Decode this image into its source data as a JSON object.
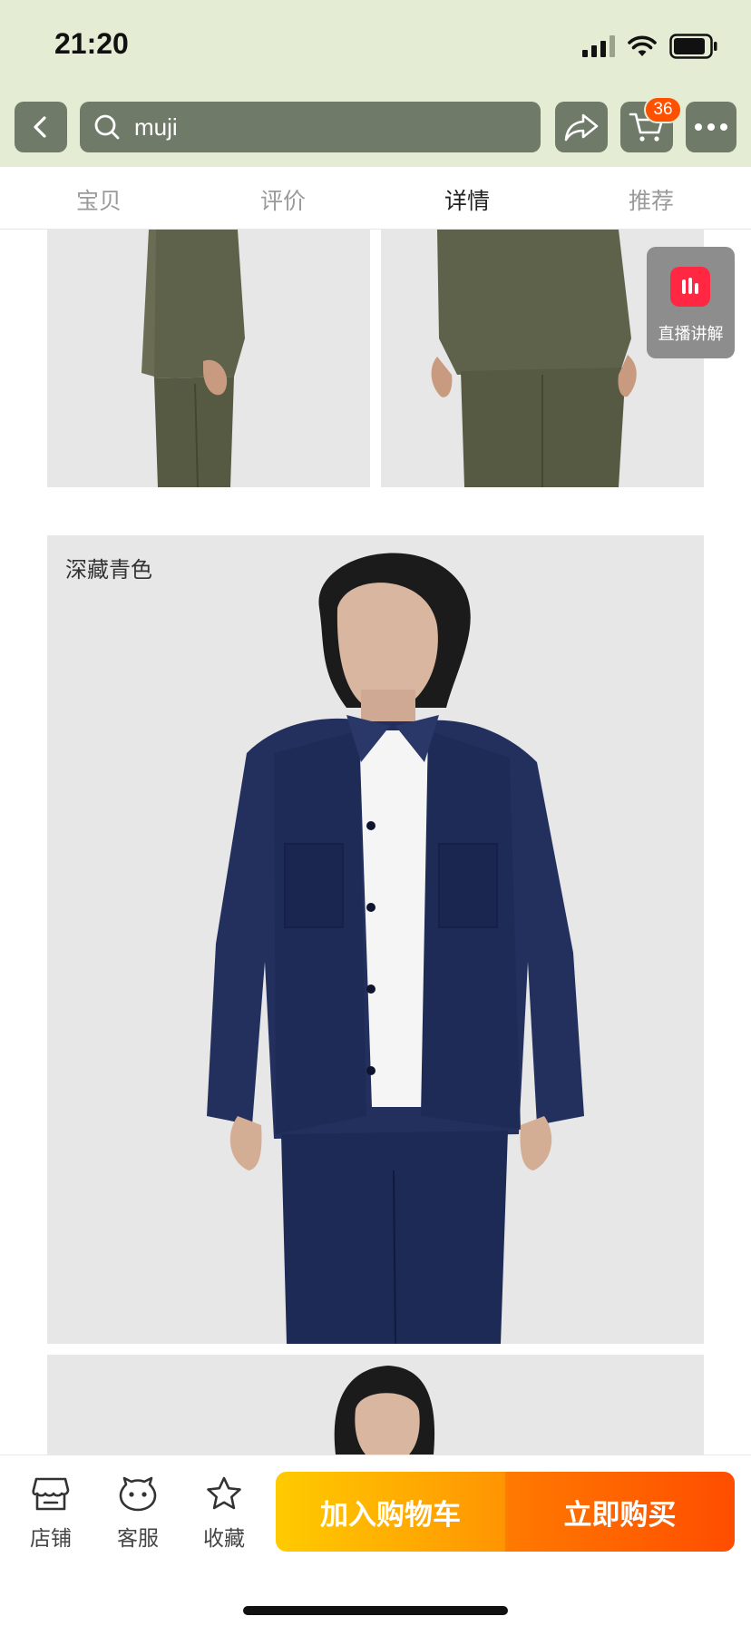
{
  "status_bar": {
    "time": "21:20",
    "signal_icon": "cellular-signal-icon",
    "wifi_icon": "wifi-icon",
    "battery_icon": "battery-icon"
  },
  "nav_bar": {
    "back_icon": "chevron-left-icon",
    "search": {
      "icon": "search-icon",
      "value": "muji"
    },
    "share_icon": "share-icon",
    "cart_icon": "cart-icon",
    "cart_badge": "36",
    "more_icon": "more-icon"
  },
  "tabs": [
    {
      "label": "宝贝",
      "active": false
    },
    {
      "label": "评价",
      "active": false
    },
    {
      "label": "详情",
      "active": true
    },
    {
      "label": "推荐",
      "active": false
    }
  ],
  "content": {
    "color_caption": "深藏青色",
    "live_badge_label": "直播讲解",
    "colors": {
      "olive": "#5b5e45",
      "navy": "#1f2c55",
      "photo_bg": "#e7e7e7"
    }
  },
  "bottom_bar": {
    "actions": [
      {
        "label": "店铺",
        "icon": "store-icon"
      },
      {
        "label": "客服",
        "icon": "customer-service-icon"
      },
      {
        "label": "收藏",
        "icon": "star-icon"
      }
    ],
    "add_to_cart": "加入购物车",
    "buy_now": "立即购买"
  },
  "colors": {
    "header_bg": "#e4ecd3",
    "header_control": "#6f7a69",
    "accent_orange": "#ff5000",
    "live_red": "#ff2741"
  }
}
